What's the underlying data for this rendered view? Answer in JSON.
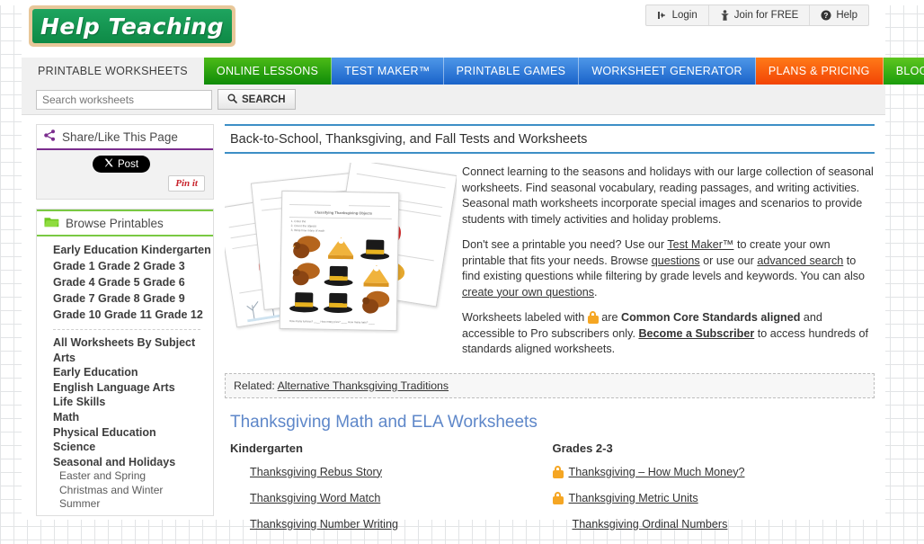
{
  "site": {
    "logo_text": "Help Teaching"
  },
  "account_bar": [
    {
      "label": "Login",
      "icon": "login-arrow-icon"
    },
    {
      "label": "Join for FREE",
      "icon": "person-icon"
    },
    {
      "label": "Help",
      "icon": "question-circle-icon"
    }
  ],
  "nav_tabs": [
    {
      "label": "PRINTABLE WORKSHEETS",
      "style": "active"
    },
    {
      "label": "ONLINE LESSONS",
      "style": "green"
    },
    {
      "label": "TEST MAKER™",
      "style": "blue"
    },
    {
      "label": "PRINTABLE GAMES",
      "style": "blue"
    },
    {
      "label": "WORKSHEET GENERATOR",
      "style": "blue"
    },
    {
      "label": "PLANS & PRICING",
      "style": "orange"
    },
    {
      "label": "BLOG",
      "style": "green2"
    }
  ],
  "search": {
    "placeholder": "Search worksheets",
    "value": "",
    "button_label": "SEARCH"
  },
  "sidebar": {
    "share_panel": {
      "title": "Share/Like This Page",
      "x_post_label": "Post",
      "pinit_label": "Pin it"
    },
    "browse_panel": {
      "title": "Browse Printables",
      "grade_rows": [
        [
          "Early Education",
          "Kindergarten"
        ],
        [
          "Grade 1",
          "Grade 2",
          "Grade 3"
        ],
        [
          "Grade 4",
          "Grade 5",
          "Grade 6"
        ],
        [
          "Grade 7",
          "Grade 8",
          "Grade 9"
        ],
        [
          "Grade 10",
          "Grade 11",
          "Grade 12"
        ]
      ],
      "subjects": [
        {
          "label": "All Worksheets By Subject",
          "sub": false
        },
        {
          "label": "Arts",
          "sub": false
        },
        {
          "label": "Early Education",
          "sub": false
        },
        {
          "label": "English Language Arts",
          "sub": false
        },
        {
          "label": "Life Skills",
          "sub": false
        },
        {
          "label": "Math",
          "sub": false
        },
        {
          "label": "Physical Education",
          "sub": false
        },
        {
          "label": "Science",
          "sub": false
        },
        {
          "label": "Seasonal and Holidays",
          "sub": false
        },
        {
          "label": "Easter and Spring",
          "sub": true
        },
        {
          "label": "Christmas and Winter",
          "sub": true
        },
        {
          "label": "Summer",
          "sub": true
        }
      ]
    }
  },
  "main": {
    "page_title": "Back-to-School, Thanksgiving, and Fall Tests and Worksheets",
    "paragraph1": "Connect learning to the seasons and holidays with our large collection of seasonal worksheets. Find seasonal vocabulary, reading passages, and writing activities. Seasonal math worksheets incorporate special images and scenarios to provide students with timely activities and holiday problems.",
    "paragraph2": {
      "t1": "Don't see a printable you need? Use our ",
      "link1": "Test Maker™",
      "t2": " to create your own printable that fits your needs. Browse ",
      "link2": "questions",
      "t3": " or use our ",
      "link3": "advanced search",
      "t4": " to find existing questions while filtering by grade levels and keywords. You can also ",
      "link4": "create your own questions",
      "t5": "."
    },
    "paragraph3": {
      "t1": "Worksheets labeled with ",
      "t2": " are ",
      "bold1": "Common Core Standards aligned",
      "t3": " and accessible to Pro subscribers only. ",
      "link1": "Become a Subscriber",
      "t4": " to access hundreds of standards aligned worksheets."
    },
    "related": {
      "label": "Related:",
      "link": "Alternative Thanksgiving Traditions"
    },
    "section_title": "Thanksgiving Math and ELA Worksheets",
    "columns": [
      {
        "heading": "Kindergarten",
        "items": [
          {
            "label": "Thanksgiving Rebus Story",
            "locked": false
          },
          {
            "label": "Thanksgiving Word Match",
            "locked": false
          },
          {
            "label": "Thanksgiving Number Writing",
            "locked": false
          }
        ]
      },
      {
        "heading": "Grades 2-3",
        "items": [
          {
            "label": "Thanksgiving – How Much Money?",
            "locked": true
          },
          {
            "label": "Thanksgiving Metric Units",
            "locked": true
          },
          {
            "label": "Thanksgiving Ordinal Numbers",
            "locked": false
          }
        ]
      }
    ]
  },
  "colors": {
    "logo_green": "#0e8a46",
    "logo_frame": "#e8c79a",
    "tab_green": "#1a9c0c",
    "tab_blue": "#1a63c9",
    "tab_orange": "#f24405",
    "title_rule": "#3d8fc6",
    "section_title": "#5e87c9",
    "lock_orange": "#f5a623",
    "share_rule": "#7b2d8e",
    "browse_rule": "#7ac943"
  }
}
